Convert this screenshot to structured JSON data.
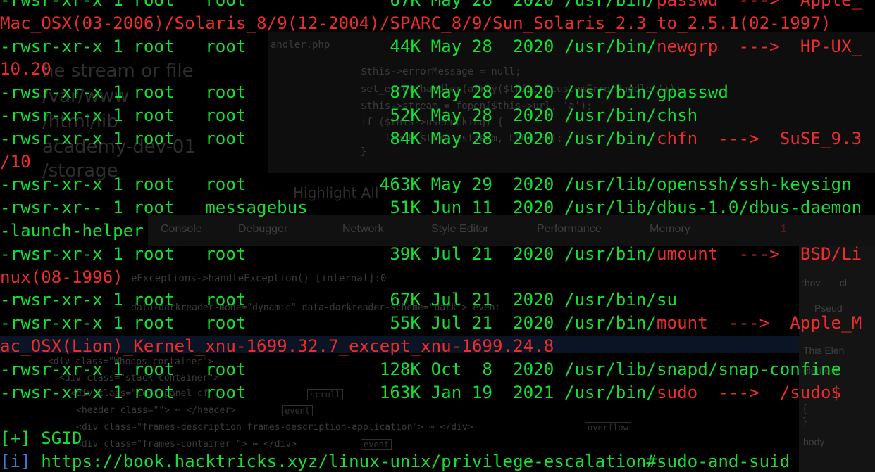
{
  "background": {
    "editor_file": "andler.php",
    "editor_code": [
      "$this->errorMessage = null;",
      "set_error_handler(array($this, 'customErrorHandler'));",
      "$this->stream = fopen($this->url, 'a');",
      "if ($this->useLocking) {",
      "    flock($this->stream, LOCK_EX);",
      "}"
    ],
    "ghost_text_left": [
      "he stream or file",
      "/var/www",
      "/html/lib",
      "academy-dev-01",
      "/storage"
    ],
    "find_bar": "Highlight All",
    "devtools_tabs": [
      "Console",
      "Debugger",
      "Network",
      "Style Editor",
      "Performance",
      "Memory"
    ],
    "error_count": "1",
    "stack_frame": "eExceptions->handleException() [internal]:0",
    "dom_lines": [
      "data-darkreader-mode=\"dynamic\" data-darkreader-scheme=\"dark\"> event",
      "<div class=\"Whoops container\">",
      "<div class=\"stack-container\">",
      "<div class=\"left-panel cf \">",
      "<header class=\"\"> ⋯ </header>",
      "<div class=\"frames-description frames-description-application\"> ⋯ </div>",
      "<div class=\"frames-container \"> ⋯ </div>"
    ],
    "dom_tags": [
      "scroll",
      "event",
      "overflow",
      "event"
    ],
    "sidebar_items": [
      ":hov",
      ".cl",
      "Pseud",
      "This Elen",
      "element",
      "{",
      "}",
      "body"
    ]
  },
  "terminal": {
    "lines": [
      [
        {
          "t": "-rwsr-xr-x 1 root   root              67K May 28  2020 /usr/bin/",
          "c": "green"
        },
        {
          "t": "passwd  --->  Apple_",
          "c": "red"
        }
      ],
      [
        {
          "t": "Mac_OSX(03-2006)/Solaris_8/9(12-2004)/SPARC_8/9/Sun_Solaris_2.3_to_2.5.1(02-1997)",
          "c": "red"
        }
      ],
      [
        {
          "t": "-rwsr-xr-x 1 root   root              44K May 28  2020 /usr/bin/",
          "c": "green"
        },
        {
          "t": "newgrp  --->  HP-UX_",
          "c": "red"
        }
      ],
      [
        {
          "t": "10.20",
          "c": "red"
        }
      ],
      [
        {
          "t": "-rwsr-xr-x 1 root   root              87K May 28  2020 /usr/bin/gpasswd",
          "c": "green"
        }
      ],
      [
        {
          "t": "-rwsr-xr-x 1 root   root              52K May 28  2020 /usr/bin/chsh",
          "c": "green"
        }
      ],
      [
        {
          "t": "-rwsr-xr-x 1 root   root              84K May 28  2020 /usr/bin/",
          "c": "green"
        },
        {
          "t": "chfn  --->  SuSE_9.3",
          "c": "red"
        }
      ],
      [
        {
          "t": "/10",
          "c": "red"
        }
      ],
      [
        {
          "t": "-rwsr-xr-x 1 root   root             463K May 29  2020 /usr/lib/openssh/ssh-keysign",
          "c": "green"
        }
      ],
      [
        {
          "t": "-rwsr-xr-- 1 root   messagebus        51K Jun 11  2020 /usr/lib/dbus-1.0/dbus-daemon",
          "c": "green"
        }
      ],
      [
        {
          "t": "-launch-helper",
          "c": "green"
        }
      ],
      [
        {
          "t": "-rwsr-xr-x 1 root   root              39K Jul 21  2020 /usr/bin/",
          "c": "green"
        },
        {
          "t": "umount  --->  BSD/Li",
          "c": "red"
        }
      ],
      [
        {
          "t": "nux(08-1996)",
          "c": "red"
        }
      ],
      [
        {
          "t": "-rwsr-xr-x 1 root   root              67K Jul 21  2020 /usr/bin/su",
          "c": "green"
        }
      ],
      [
        {
          "t": "-rwsr-xr-x 1 root   root              55K Jul 21  2020 /usr/bin/",
          "c": "green"
        },
        {
          "t": "mount  --->  Apple_M",
          "c": "red"
        }
      ],
      [
        {
          "t": "ac_OSX(Lion)_Kernel_xnu-1699.32.7_except_xnu-1699.24.8",
          "c": "red"
        }
      ],
      [
        {
          "t": "-rwsr-xr-x 1 root   root             128K Oct  8  2020 /usr/lib/snapd/snap-confine",
          "c": "green"
        }
      ],
      [
        {
          "t": "-rwsr-xr-x 1 root   root             163K Jan 19  2021 /usr/bin/",
          "c": "green"
        },
        {
          "t": "sudo  --->  /sudo$",
          "c": "red"
        }
      ],
      [
        {
          "t": "",
          "c": "green"
        }
      ],
      [
        {
          "t": "[+] SGID",
          "c": "green"
        }
      ],
      [
        {
          "t": "[i] ",
          "c": "blue"
        },
        {
          "t": "https://book.hacktricks.xyz/linux-unix/privilege-escalation#sudo-and-suid",
          "c": "green"
        }
      ]
    ]
  },
  "colors": {
    "background": "#000000",
    "normal": "#13e032",
    "highlight": "#ee2c2c",
    "info": "#3c78d8"
  }
}
